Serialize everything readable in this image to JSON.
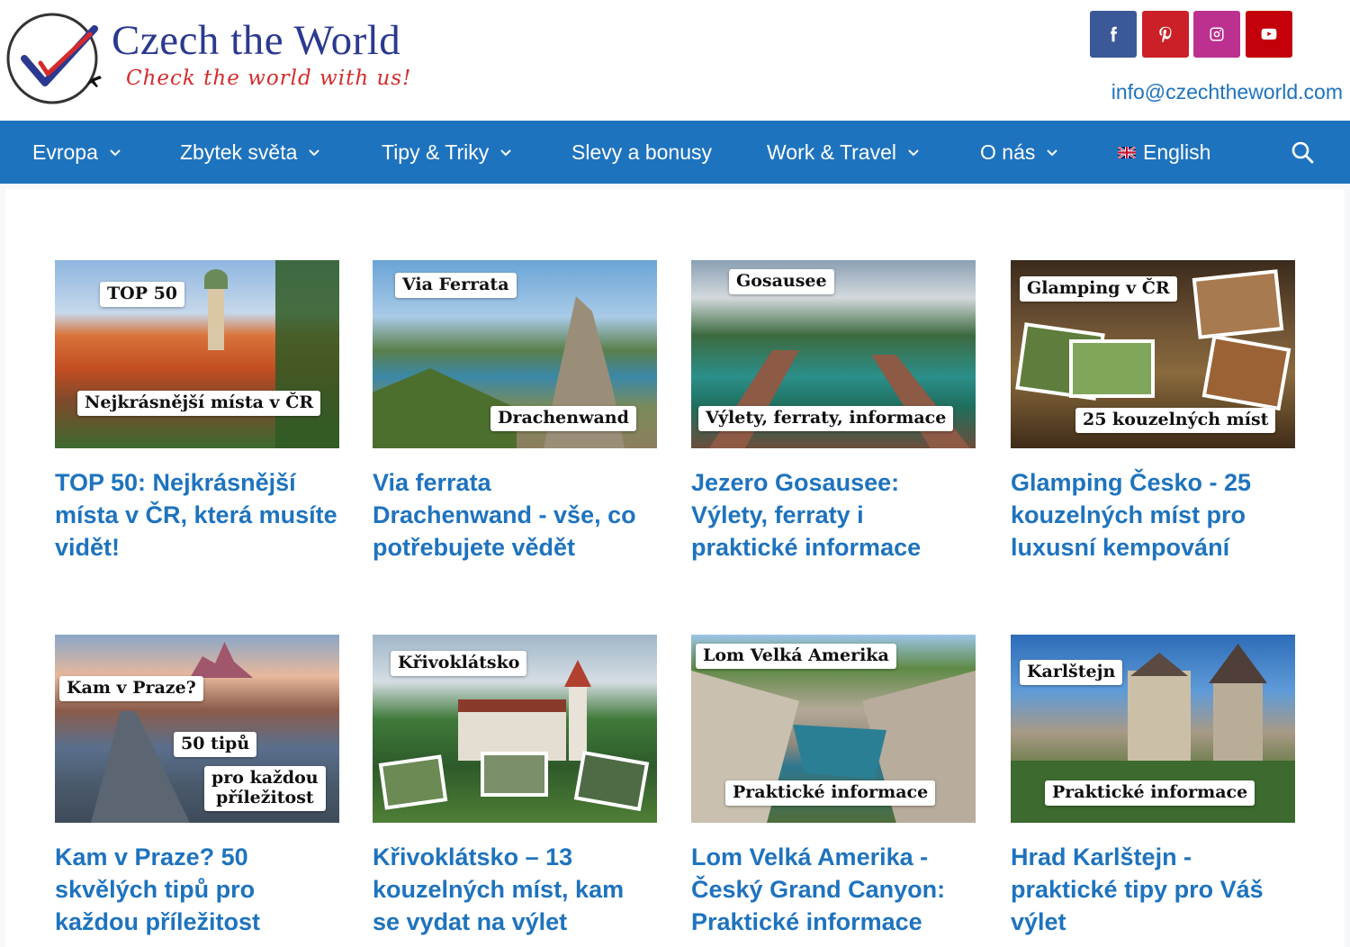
{
  "brand": {
    "name": "Czech the World",
    "tagline": "Check the world with us!",
    "email": "info@czechtheworld.com"
  },
  "social": [
    {
      "icon": "facebook-icon",
      "color": "#3b5998"
    },
    {
      "icon": "pinterest-icon",
      "color": "#cb2027"
    },
    {
      "icon": "instagram-icon",
      "color": "#bc318f"
    },
    {
      "icon": "youtube-icon",
      "color": "#c4000a"
    }
  ],
  "nav": {
    "items": [
      {
        "label": "Evropa",
        "dropdown": true
      },
      {
        "label": "Zbytek světa",
        "dropdown": true
      },
      {
        "label": "Tipy & Triky",
        "dropdown": true
      },
      {
        "label": "Slevy a bonusy",
        "dropdown": false
      },
      {
        "label": "Work & Travel",
        "dropdown": true
      },
      {
        "label": "O nás",
        "dropdown": true
      },
      {
        "label": "English",
        "dropdown": false,
        "icon": "uk-flag-icon"
      }
    ],
    "search_icon": "search-icon"
  },
  "posts": [
    {
      "title": "TOP 50: Nejkrásnější místa v ČR, která musíte vidět!",
      "labels": [
        "TOP 50",
        "Nejkrásnější místa v ČR"
      ]
    },
    {
      "title": "Via ferrata Drachenwand - vše, co potřebujete vědět",
      "labels": [
        "Via Ferrata",
        "Drachenwand"
      ]
    },
    {
      "title": "Jezero Gosausee: Výlety, ferraty i praktické informace",
      "labels": [
        "Gosausee",
        "Výlety, ferraty, informace"
      ]
    },
    {
      "title": "Glamping Česko - 25 kouzelných míst pro luxusní kempování",
      "labels": [
        "Glamping v ČR",
        "25 kouzelných míst"
      ]
    },
    {
      "title": "Kam v Praze? 50 skvělých tipů pro každou příležitost",
      "labels": [
        "Kam v Praze?",
        "50 tipů",
        "pro každou\npříležitost"
      ]
    },
    {
      "title": "Křivoklátsko – 13 kouzelných míst, kam se vydat na výlet",
      "labels": [
        "Křivoklátsko"
      ]
    },
    {
      "title": "Lom Velká Amerika - Český Grand Canyon: Praktické informace",
      "labels": [
        "Lom Velká Amerika",
        "Praktické informace"
      ]
    },
    {
      "title": "Hrad Karlštejn - praktické tipy pro Váš výlet",
      "labels": [
        "Karlštejn",
        "Praktické informace"
      ]
    }
  ],
  "colors": {
    "brand_blue": "#1e73be",
    "logo_navy": "#2b3990",
    "logo_red": "#d52b2b"
  }
}
